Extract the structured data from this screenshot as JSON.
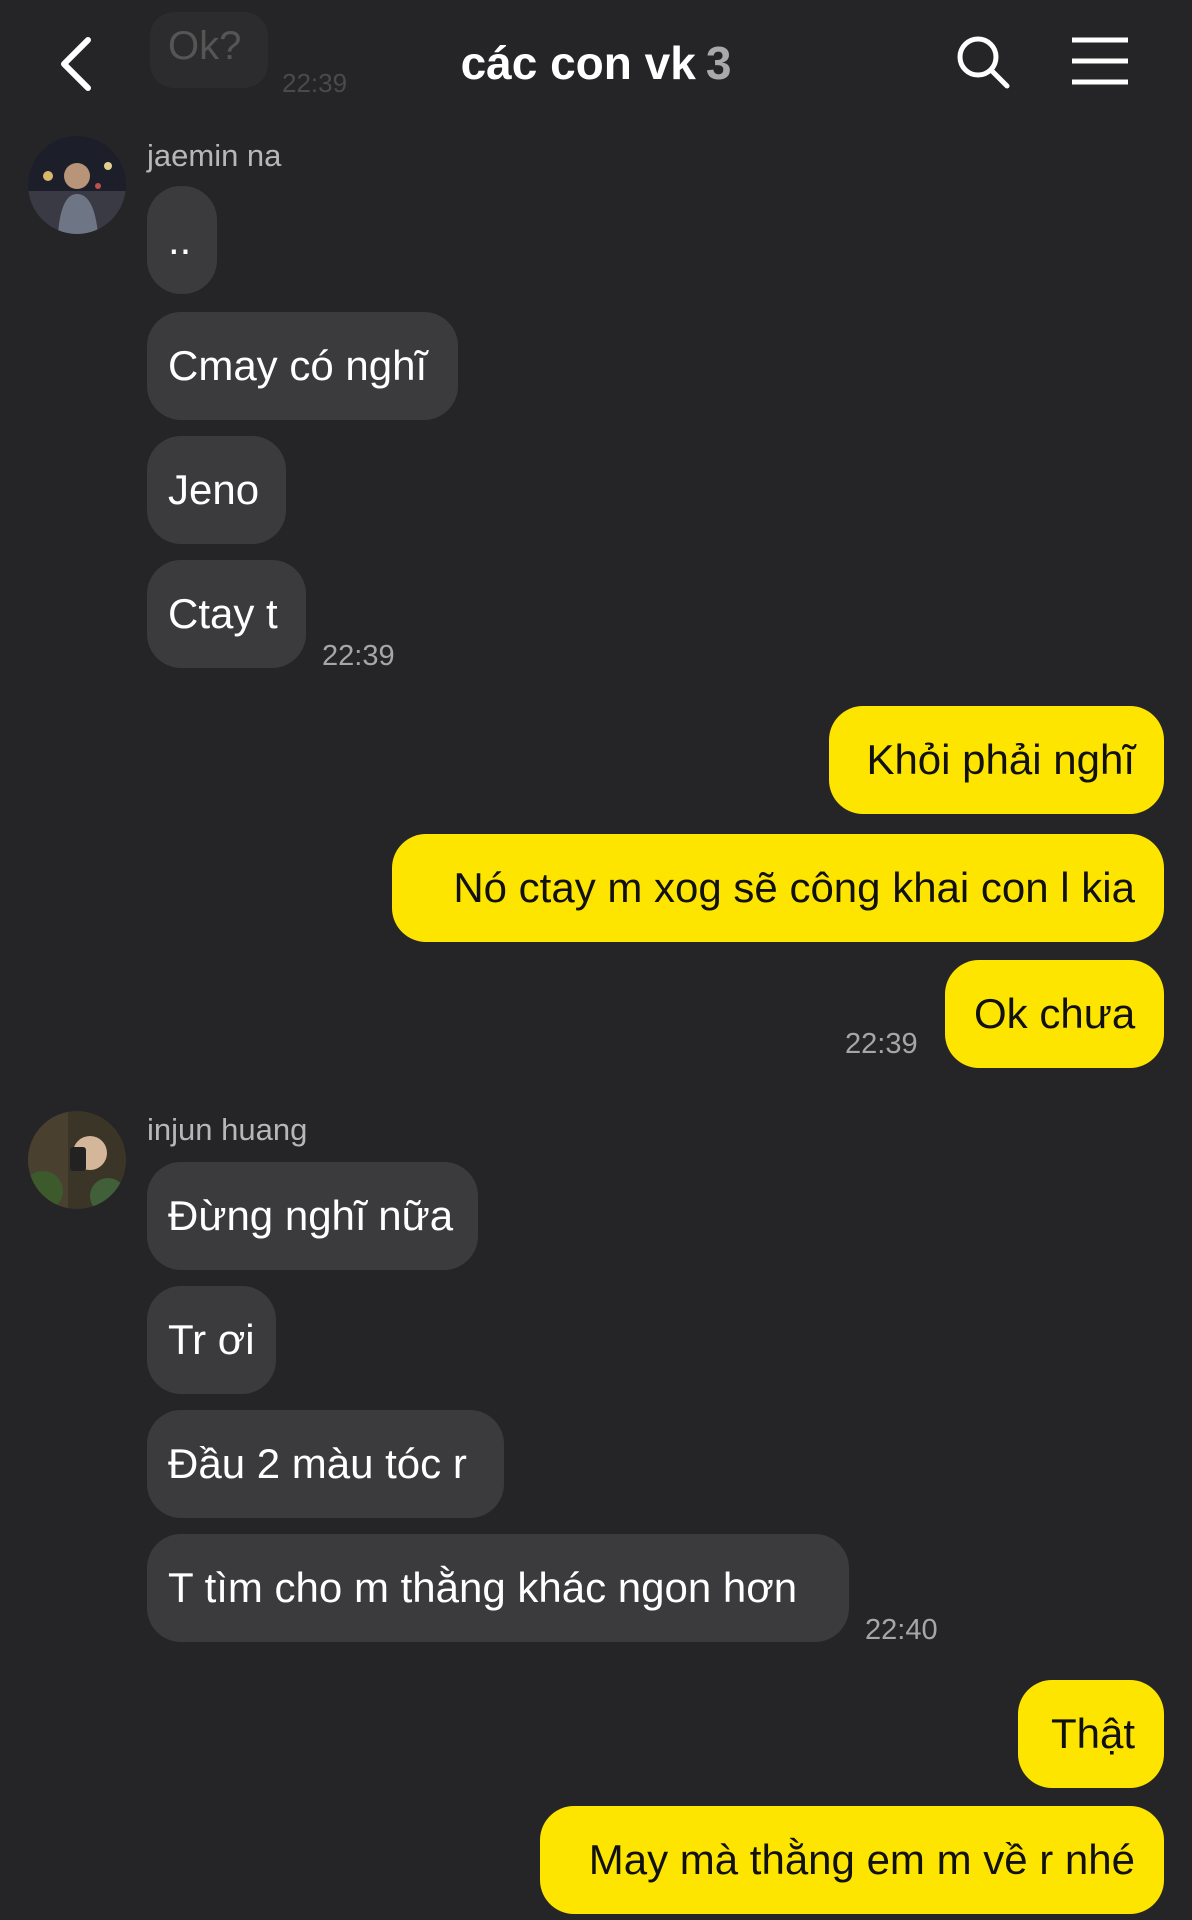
{
  "header": {
    "title": "các con vk",
    "member_count": "3",
    "back_icon": "chevron-left-icon",
    "search_icon": "search-icon",
    "menu_icon": "hamburger-menu-icon"
  },
  "previous": {
    "text": "Ok?",
    "time": "22:39"
  },
  "messages": {
    "m1": {
      "sender": "jaemin na",
      "lines": [
        "..",
        "Cmay có nghĩ",
        "Jeno",
        "Ctay t"
      ],
      "time": "22:39"
    },
    "m2": {
      "lines": [
        "Khỏi phải nghĩ",
        "Nó ctay m xog sẽ công khai con l kia",
        "Ok chưa"
      ],
      "time": "22:39"
    },
    "m3": {
      "sender": "injun huang",
      "lines": [
        "Đừng nghĩ nữa",
        "Tr ơi",
        "Đầu 2 màu tóc r",
        "T tìm cho m thằng khác ngon hơn"
      ],
      "time": "22:40"
    },
    "m4": {
      "lines": [
        "Thật",
        "May mà thằng em m về r nhé"
      ]
    }
  },
  "colors": {
    "background": "#252527",
    "incoming": "#3b3b3d",
    "outgoing": "#fee500"
  }
}
